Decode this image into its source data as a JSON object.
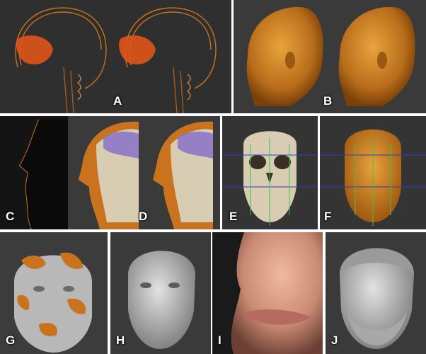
{
  "panels": {
    "A": {
      "label": "A",
      "icon": "skull-ct-section-pair",
      "background": "#2f2f2f"
    },
    "B": {
      "label": "B",
      "icon": "head-volume-render-pair",
      "background": "#3a3a3a"
    },
    "C": {
      "label": "C",
      "icon": "face-profile-outline",
      "background": "#141414"
    },
    "D": {
      "label": "D",
      "icon": "skull-tissue-overlay-pair",
      "background": "#3a3a3a"
    },
    "E": {
      "label": "E",
      "icon": "skull-frontal-landmarks",
      "background": "#343434"
    },
    "F": {
      "label": "F",
      "icon": "face-frontal-landmarks",
      "background": "#343434"
    },
    "G": {
      "label": "G",
      "icon": "head-sculpt-patches",
      "background": "#3c3c3c"
    },
    "H": {
      "label": "H",
      "icon": "head-sculpt-gray",
      "background": "#3a3a3a"
    },
    "I": {
      "label": "I",
      "icon": "skin-texture-closeup",
      "background": "#1a1a1a"
    },
    "J": {
      "label": "J",
      "icon": "head-sculpt-hair-beard",
      "background": "#3a3a3a"
    }
  },
  "colors": {
    "orange": "#c9731f",
    "orange_dark": "#8a4408",
    "bone": "#d8cdb2",
    "purple": "#8b72c8",
    "sculpt_gray": "#b8b8b8",
    "skin": "#d79a84",
    "landmark_green": "#3cc24a",
    "landmark_blue": "#2b3cc8"
  }
}
